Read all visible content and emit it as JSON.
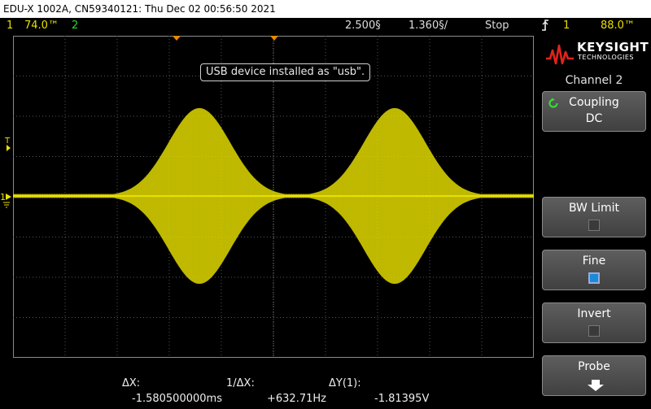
{
  "title_bar": {
    "text": "EDU-X 1002A, CN59340121: Thu Dec 02 00:56:50 2021"
  },
  "status": {
    "ch1_number": "1",
    "ch1_scale": "74.0™",
    "ch2_number": "2",
    "timebase": "2.500§",
    "delay": "1.360§/",
    "run_state": "Stop",
    "trigger_icon": "trigger-edge-icon",
    "trigger_channel": "1",
    "trigger_level": "88.0™"
  },
  "message": {
    "text": "USB device installed as \"usb\"."
  },
  "logo": {
    "name": "KEYSIGHT",
    "sub": "TECHNOLOGIES"
  },
  "menu": {
    "title": "Channel 2",
    "softkeys": [
      {
        "label": "Coupling",
        "value": "DC"
      },
      {
        "label": "BW Limit",
        "checked": false
      },
      {
        "label": "Fine",
        "checked": true
      },
      {
        "label": "Invert",
        "checked": false
      },
      {
        "label": "Probe",
        "icon": "down-arrow-icon"
      }
    ]
  },
  "readout": {
    "dx_label": "ΔX:",
    "dx_value": "-1.580500000ms",
    "inv_dx_label": "1/ΔX:",
    "inv_dx_value": "+632.71Hz",
    "dy_label": "ΔY(1):",
    "dy_value": "-1.81395V"
  },
  "waveform": {
    "color": "#e8e000",
    "channel_marker": "1",
    "trigger_marker": "T",
    "bursts": 2
  }
}
